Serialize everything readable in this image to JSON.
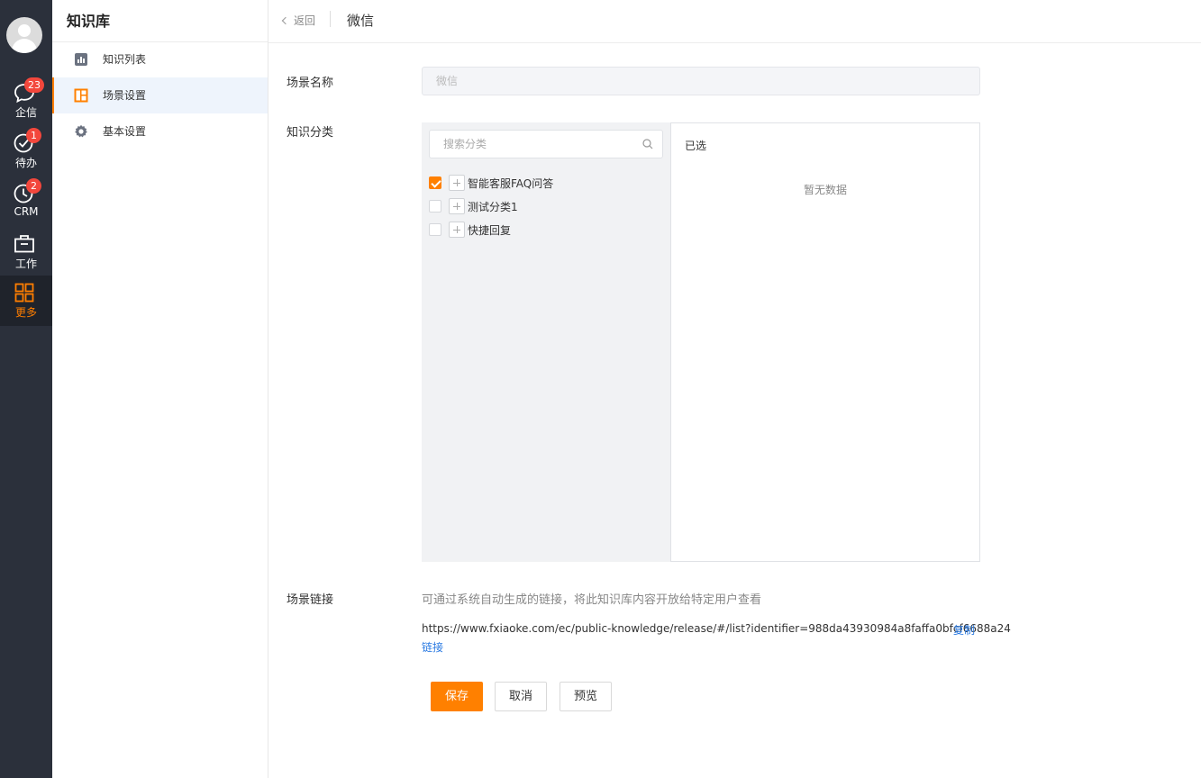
{
  "rail": {
    "items": [
      {
        "label": "企信",
        "badge": "23"
      },
      {
        "label": "待办",
        "badge": "1"
      },
      {
        "label": "CRM",
        "badge": "2"
      },
      {
        "label": "工作"
      },
      {
        "label": "更多"
      }
    ],
    "active_color": "#ff7e00"
  },
  "sidebar": {
    "title": "知识库",
    "items": [
      {
        "label": "知识列表",
        "icon": "bar-chart-icon"
      },
      {
        "label": "场景设置",
        "icon": "layout-grid-icon",
        "active": true
      },
      {
        "label": "基本设置",
        "icon": "gear-icon"
      }
    ]
  },
  "header": {
    "back_label": "返回",
    "title": "微信"
  },
  "form": {
    "scene_name_label": "场景名称",
    "scene_name_value": "微信",
    "category_label": "知识分类",
    "search_placeholder": "搜索分类",
    "tree": [
      {
        "label": "智能客服FAQ问答",
        "checked": true
      },
      {
        "label": "测试分类1",
        "checked": false
      },
      {
        "label": "快捷回复",
        "checked": false
      }
    ],
    "selected_title": "已选",
    "empty_text": "暂无数据",
    "link_label": "场景链接",
    "link_description": "可通过系统自动生成的链接，将此知识库内容开放给特定用户查看",
    "link_url": "https://www.fxiaoke.com/ec/public-knowledge/release/#/list?identifier=988da43930984a8faffa0bfcf6688a24",
    "copy_link_1": "复制",
    "copy_link_2": "链接"
  },
  "buttons": {
    "save": "保存",
    "cancel": "取消",
    "preview": "预览"
  },
  "colors": {
    "brand": "#ff8000",
    "link": "#2a7ae2",
    "rail_bg": "#2b303b",
    "badge": "#f3473c"
  }
}
